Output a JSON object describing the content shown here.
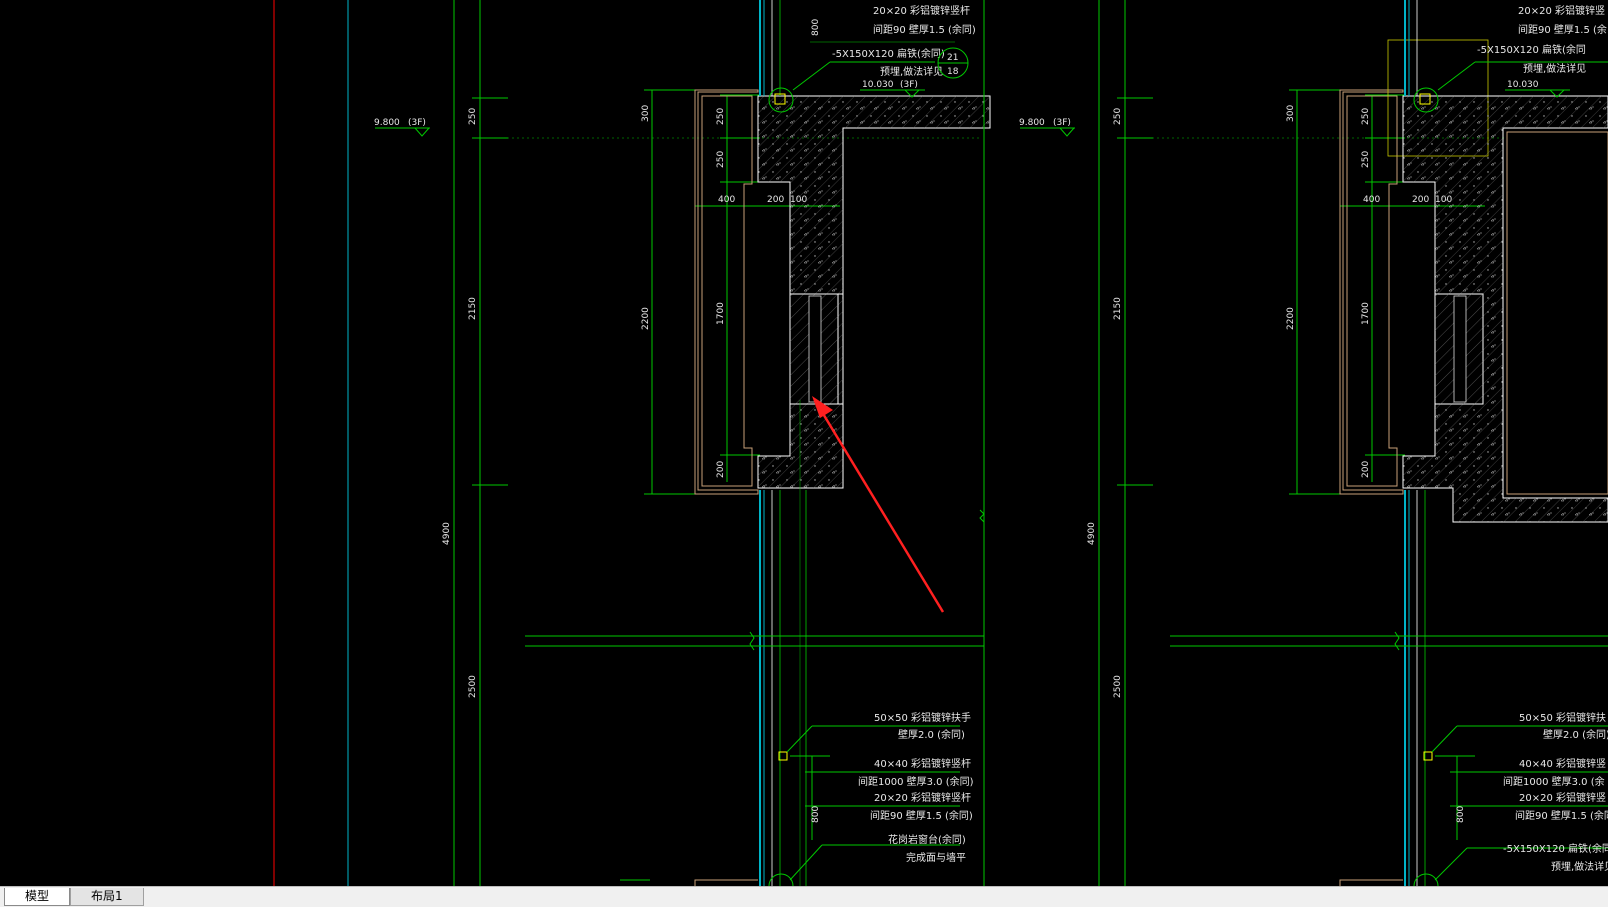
{
  "layout_tabs": [
    {
      "label": "模型",
      "active": true
    },
    {
      "label": "布局1",
      "active": false
    }
  ],
  "drawing": {
    "background": "#000000",
    "colors": {
      "green": "#00c800",
      "cyan": "#00b4c8",
      "red": "#ff0000",
      "tan": "#c8a078",
      "white": "#ffffff",
      "yellow": "#c8c800",
      "annotation_arrow": "#ff2020"
    },
    "left": {
      "elev_level": "9.800",
      "elev_floor": "(3F)",
      "dims_col1": [
        "250",
        "2150",
        "4900",
        "2500"
      ],
      "dims_col2": [
        "300",
        "2200"
      ],
      "dims_col3": [
        "250",
        "250",
        "1700",
        "200"
      ],
      "dims_horiz": [
        "400",
        "200",
        "100"
      ],
      "dim_800a": "800",
      "dim_800b": "800",
      "elev_roof_level": "10.030",
      "elev_roof_floor": "(3F)",
      "top_notes": [
        "20×20  彩铝镀锌竖杆",
        "间距90  壁厚1.5 (余同)",
        "-5X150X120    扁铁(余同)",
        "预埋,做法详见"
      ],
      "detail_ref_top": "21",
      "detail_ref_bottom": "18",
      "bottom_notes": [
        "50×50  彩铝镀锌扶手",
        "壁厚2.0 (余同)",
        "40×40  彩铝镀锌竖杆",
        "间距1000  壁厚3.0 (余同)",
        "20×20  彩铝镀锌竖杆",
        "间距90  壁厚1.5 (余同)",
        "花岗岩窗台(余同)",
        "完成面与墙平"
      ]
    },
    "right": {
      "elev_level": "9.800",
      "elev_floor": "(3F)",
      "dims_col1": [
        "250",
        "2150",
        "4900",
        "2500"
      ],
      "dims_col2": [
        "300",
        "2200"
      ],
      "dims_col3": [
        "250",
        "250",
        "1700",
        "200"
      ],
      "dims_horiz": [
        "400",
        "200",
        "100"
      ],
      "dim_800": "800",
      "elev_roof_level": "10.030",
      "top_notes": [
        "20×20  彩铝镀锌竖",
        "间距90  壁厚1.5 (余",
        "-5X150X120    扁铁(余同",
        "预埋,做法详见"
      ],
      "bottom_notes": [
        "50×50  彩铝镀锌扶",
        "壁厚2.0 (余同)",
        "40×40  彩铝镀锌竖",
        "间距1000  壁厚3.0 (余",
        "20×20  彩铝镀锌竖",
        "间距90  壁厚1.5 (余同)",
        "-5X150X120    扁铁(余同",
        "预埋,做法详见"
      ]
    }
  }
}
